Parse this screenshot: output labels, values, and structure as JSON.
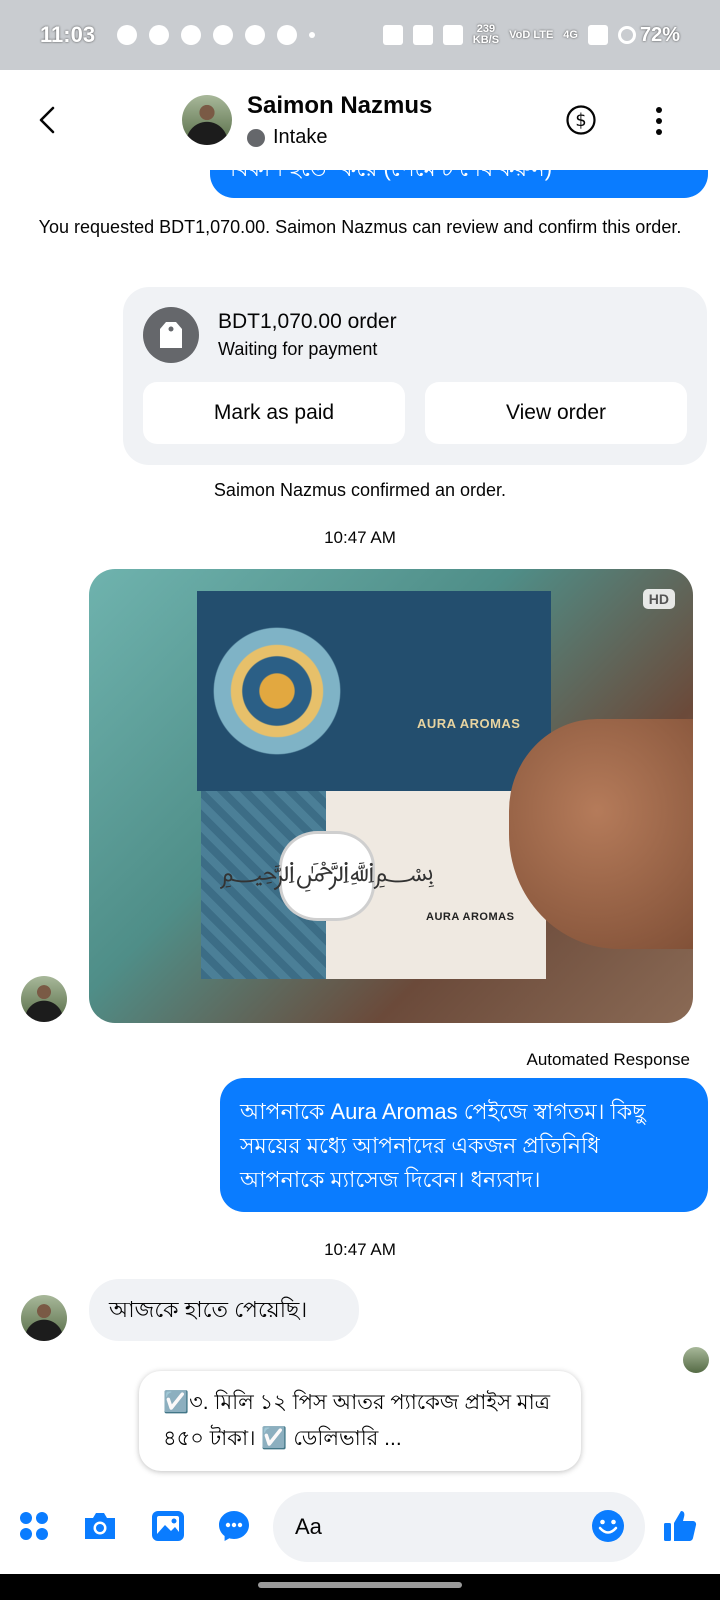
{
  "status_bar": {
    "time": "11:03",
    "net_speed": "239",
    "net_unit": "KB/S",
    "vo_label": "VoD LTE",
    "net_type": "4G",
    "battery": "72%"
  },
  "header": {
    "contact_name": "Saimon Nazmus",
    "contact_status": "Intake"
  },
  "chat": {
    "partial_text": "বিকাশ হতে *করে (পেমেন্ট শেষ করুন)",
    "request_text": "You requested BDT1,070.00. Saimon Nazmus can review and confirm this order.",
    "order": {
      "title": "BDT1,070.00 order",
      "subtitle": "Waiting for payment",
      "mark_paid_label": "Mark as paid",
      "view_order_label": "View order"
    },
    "confirmed_text": "Saimon Nazmus confirmed an order.",
    "time_1": "10:47 AM",
    "photo": {
      "hd_badge": "HD",
      "brand_top": "AURA AROMAS",
      "brand_bottom": "AURA AROMAS"
    },
    "automated_label": "Automated Response",
    "auto_message": "আপনাকে Aura Aromas পেইজে স্বাগতম। কিছু সময়ের মধ্যে আপনাদের একজন প্রতিনিধি আপনাকে ম্যাসেজ দিবেন। ধন্যবাদ।",
    "time_2": "10:47 AM",
    "incoming_message": "আজকে হাতে পেয়েছি।",
    "quick_reply": "☑️৩. মিলি ১২ পিস আতর প্যাকেজ প্রাইস মাত্র ৪৫০ টাকা। ☑️ ডেলিভারি ..."
  },
  "composer": {
    "placeholder": "Aa"
  },
  "colors": {
    "accent": "#0a7cff",
    "bubble_gray": "#f0f2f5",
    "status_bar": "#c9ccd0"
  },
  "icons": [
    "chevron-left-icon",
    "dollar-icon",
    "more-vertical-icon",
    "tag-icon",
    "apps-icon",
    "camera-icon",
    "gallery-icon",
    "chat-bubble-icon",
    "emoji-icon",
    "thumbs-up-icon"
  ]
}
